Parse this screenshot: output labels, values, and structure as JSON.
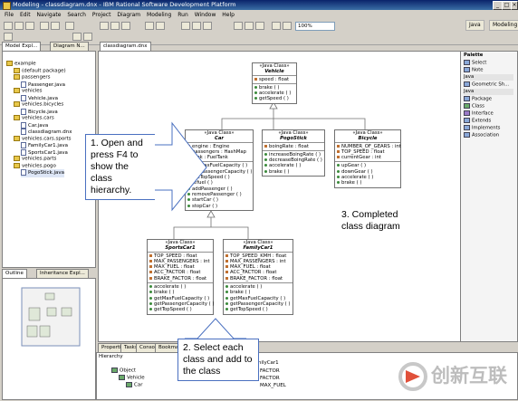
{
  "window": {
    "title": "Modeling - classdiagram.dnx - IBM Rational Software Development Platform"
  },
  "menu": [
    "File",
    "Edit",
    "Navigate",
    "Search",
    "Project",
    "Diagram",
    "Modeling",
    "Run",
    "Window",
    "Help"
  ],
  "toolbar": {
    "zoom": "100%",
    "perspectives": [
      "Java",
      "Modeling"
    ]
  },
  "left_panel": {
    "tabs": [
      "Model Expl...",
      "Diagram N..."
    ],
    "tree": [
      "example",
      "(default package)",
      "passengers",
      "Passenger.java",
      "vehicles",
      "Vehicle.java",
      "vehicles.bicycles",
      "Bicycle.java",
      "vehicles.cars",
      "Car.java",
      "classdiagram.dnx",
      "vehicles.cars.sports",
      "FamilyCar1.java",
      "SportsCar1.java",
      "vehicles.parts",
      "vehicles.pogo",
      "PogoStick.java"
    ]
  },
  "outline": {
    "tabs": [
      "Outline",
      "Inheritance Expl..."
    ]
  },
  "editor": {
    "tab": "classdiagram.dnx"
  },
  "classes": {
    "stereotype": "«Java Class»",
    "vehicle": {
      "name": "Vehicle",
      "attrs": [
        "speed : float"
      ],
      "ops": [
        "brake ( )",
        "accelerate ( )",
        "getSpeed ( )"
      ]
    },
    "car": {
      "name": "Car",
      "attrs": [
        "engine : Engine",
        "passengers : HashMap",
        "tank : FuelTank"
      ],
      "ops": [
        "getMaxFuelCapacity ( )",
        "getPassengerCapacity ( )",
        "getTopSpeed ( )",
        "refuel ( )",
        "addPassenger ( )",
        "removePassenger ( )",
        "startCar ( )",
        "stopCar ( )"
      ]
    },
    "pogostick": {
      "name": "PogoStick",
      "attrs": [
        "boingRate : float"
      ],
      "ops": [
        "increaseBoingRate ( )",
        "decreaseBoingRate ( )",
        "accelerate ( )",
        "brake ( )"
      ]
    },
    "bicycle": {
      "name": "Bicycle",
      "attrs": [
        "NUMBER_OF_GEARS : int",
        "TOP_SPEED : float",
        "currentGear : int"
      ],
      "ops": [
        "upGear ( )",
        "downGear ( )",
        "accelerate ( )",
        "brake ( )"
      ]
    },
    "sportscar1": {
      "name": "SportsCar1",
      "attrs": [
        "TOP_SPEED : float",
        "MAX_PASSENGERS : int",
        "MAX_FUEL : float",
        "ACC_FACTOR : float",
        "BRAKE_FACTOR : float"
      ],
      "ops": [
        "accelerate ( )",
        "brake ( )",
        "getMaxFuelCapacity ( )",
        "getPassengerCapacity ( )",
        "getTopSpeed ( )"
      ]
    },
    "familycar1": {
      "name": "FamilyCar1",
      "attrs": [
        "TOP_SPEED_KMH : float",
        "MAX_PASSENGERS : int",
        "MAX_FUEL : float",
        "ACC_FACTOR : float",
        "BRAKE_FACTOR : float"
      ],
      "ops": [
        "accelerate ( )",
        "brake ( )",
        "getMaxFuelCapacity ( )",
        "getPassengerCapacity ( )",
        "getTopSpeed ( )"
      ]
    }
  },
  "callouts": {
    "c1": "1. Open and press F4 to show the class hierarchy.",
    "c2": "2. Select each class and add to the class",
    "c3": "3. Completed class diagram"
  },
  "palette": {
    "title": "Palette",
    "items": [
      "Select",
      "Note",
      "Java",
      "Geometric Sh...",
      "Java",
      "Package",
      "Class",
      "Interface",
      "Extends",
      "Implements",
      "Association"
    ]
  },
  "bottom": {
    "tabs": [
      "Properties",
      "Tasks",
      "Console",
      "Bookmarks"
    ],
    "header": "Hierarchy",
    "tree": [
      "Object",
      "Vehicle",
      "Car"
    ],
    "right_tab": "FamilyCar1",
    "right_fields": [
      "FACTOR",
      "FACTOR",
      "MAX_FUEL"
    ]
  },
  "watermark": {
    "text": "创新互联"
  },
  "colors": {
    "title_start": "#0a246a",
    "callout_border": "#4a70c0",
    "class_border": "#707070"
  }
}
